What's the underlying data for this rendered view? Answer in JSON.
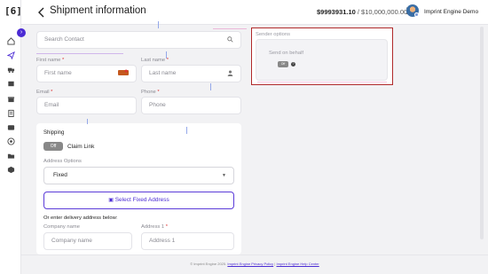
{
  "app": {
    "logo_text": "[6]",
    "title": "Shipment information",
    "balance": "$9993931.10",
    "balance_limit": "/ $10,000,000.00",
    "user_name": "Imprint Engine Demo"
  },
  "rail": {
    "icons": [
      "home-icon",
      "send-icon",
      "truck-icon",
      "box-icon",
      "gift-icon",
      "clipboard-icon",
      "wallet-icon",
      "target-icon",
      "folder-icon",
      "cube-icon"
    ],
    "active": "send-icon",
    "accent": "#4b2bd4"
  },
  "form": {
    "search_contact_placeholder": "Search Contact",
    "first_name_label": "First name",
    "first_name_placeholder": "First name",
    "last_name_label": "Last name",
    "last_name_placeholder": "Last name",
    "email_label": "Email",
    "email_placeholder": "Email",
    "phone_label": "Phone",
    "phone_placeholder": "Phone",
    "required_marker": "*"
  },
  "sender": {
    "title": "Sender options",
    "send_on_behalf_label": "Send on behalf",
    "toggle_text": "Off",
    "help_text": "?"
  },
  "shipping": {
    "title": "Shipping",
    "claim_toggle_text": "Off",
    "claim_label": "Claim Link",
    "address_options_label": "Address Options",
    "address_options_value": "Fixed",
    "select_fixed_button": "Select Fixed Address",
    "or_enter_text": "Or enter delivery address below:",
    "company_label": "Company name",
    "company_placeholder": "Company name",
    "address1_label": "Address 1",
    "address1_placeholder": "Address 1"
  },
  "footer": {
    "copyright": "© Imprint Engine 2025.",
    "privacy_link": "Imprint Engine Privacy Policy",
    "separator": "|",
    "help_link": "Imprint Engine Help Center"
  },
  "colors": {
    "accent": "#4b2bd4",
    "highlight_border": "#b02a2a"
  }
}
